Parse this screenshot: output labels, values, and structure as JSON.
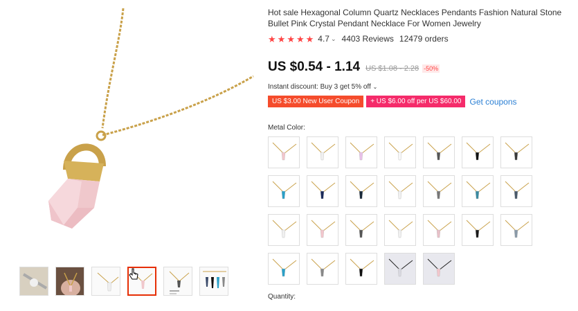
{
  "product": {
    "title": "Hot sale Hexagonal Column Quartz Necklaces Pendants Fashion Natural Stone Bullet Pink Crystal Pendant Necklace For Women Jewelry",
    "rating": "4.7",
    "reviews": "4403 Reviews",
    "orders": "12479 orders",
    "price": "US $0.54 - 1.14",
    "old_price": "US $1.08 - 2.28",
    "discount": "-50%",
    "instant_discount": "Instant discount: Buy 3 get 5% off",
    "coupon_new_user": "US $3.00 New User Coupon",
    "coupon_off": "+ US $6.00 off per US $60.00",
    "get_coupons": "Get coupons",
    "metal_color_label": "Metal Color:",
    "quantity_label": "Quantity:"
  },
  "icons": {
    "star": "star-icon",
    "caret": "chevron-down-icon",
    "cursor": "hand-pointer-icon"
  },
  "colors": {
    "accent": "#e62e04",
    "star": "#f44444",
    "coupon_orange": "#f54c2c",
    "coupon_pink": "#f52b6a",
    "link": "#2a7fd4"
  },
  "thumbnails": [
    {
      "stone": "#c0c0c0",
      "bg": "#d8d0c0"
    },
    {
      "stone": "#e8b8a8",
      "bg": "#6a5040"
    },
    {
      "stone": "#e8e8e8",
      "bg": "#ffffff"
    },
    {
      "stone": "#f0c8cc",
      "bg": "#ffffff"
    },
    {
      "stone": "#555555",
      "bg": "#ffffff"
    },
    {
      "stone": "#3a4a6a",
      "bg": "#ffffff"
    }
  ],
  "swatches": [
    {
      "stone": "#f2c6cc",
      "chain": "#c9a14a"
    },
    {
      "stone": "#f0f0f0",
      "chain": "#c9a14a"
    },
    {
      "stone": "#e8c0e8",
      "chain": "#c9a14a"
    },
    {
      "stone": "#f8f8f8",
      "chain": "#c9a14a"
    },
    {
      "stone": "#555555",
      "chain": "#c9a14a"
    },
    {
      "stone": "#111111",
      "chain": "#c9a14a"
    },
    {
      "stone": "#3a3a3a",
      "chain": "#c9a14a"
    },
    {
      "stone": "#2aa0c8",
      "chain": "#c9a14a"
    },
    {
      "stone": "#1a2a5a",
      "chain": "#c9a14a"
    },
    {
      "stone": "#1a2a3a",
      "chain": "#c9a14a"
    },
    {
      "stone": "#f0f0f0",
      "chain": "#c9a14a"
    },
    {
      "stone": "#777777",
      "chain": "#c9a14a"
    },
    {
      "stone": "#3a8aa0",
      "chain": "#c9a14a"
    },
    {
      "stone": "#4a5a6a",
      "chain": "#c9a14a"
    },
    {
      "stone": "#f0f0f0",
      "chain": "#c9a14a"
    },
    {
      "stone": "#f2c6cc",
      "chain": "#c9a14a"
    },
    {
      "stone": "#555555",
      "chain": "#c9a14a"
    },
    {
      "stone": "#f0f0f0",
      "chain": "#c9a14a"
    },
    {
      "stone": "#e8c0c8",
      "chain": "#c9a14a"
    },
    {
      "stone": "#1a1a1a",
      "chain": "#c9a14a"
    },
    {
      "stone": "#8a9aa8",
      "chain": "#c9a14a"
    },
    {
      "stone": "#2aa0c8",
      "chain": "#c9a14a"
    },
    {
      "stone": "#888888",
      "chain": "#c9a14a"
    },
    {
      "stone": "#111111",
      "chain": "#c9a14a"
    },
    {
      "stone": "#d8d8e0",
      "chain": "#222222",
      "dark": true
    },
    {
      "stone": "#f2c6cc",
      "chain": "#222222",
      "dark": true
    }
  ]
}
